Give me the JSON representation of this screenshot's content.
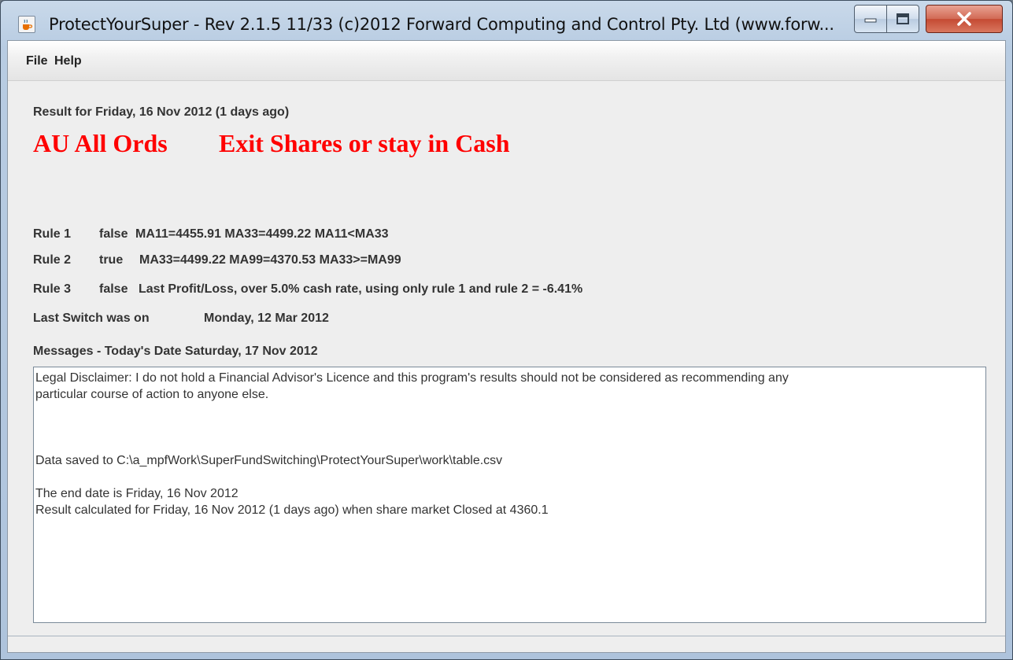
{
  "window": {
    "title": "ProtectYourSuper - Rev 2.1.5  11/33 (c)2012 Forward Computing and Control Pty. Ltd (www.forw...",
    "app_icon": "java-coffee-cup-icon",
    "controls": [
      "minimize-icon",
      "maximize-icon",
      "close-icon"
    ]
  },
  "menu": {
    "file": "File",
    "help": "Help"
  },
  "result": {
    "heading": "Result for Friday, 16 Nov 2012 (1 days ago)",
    "market": "AU All Ords",
    "advice": "Exit Shares or stay in Cash",
    "advice_color": "#ff0000"
  },
  "rules": [
    {
      "name": "Rule 1",
      "state": "false",
      "detail": "MA11=4455.91 MA33=4499.22  MA11<MA33"
    },
    {
      "name": "Rule 2",
      "state": "true",
      "detail": "MA33=4499.22 MA99=4370.53  MA33>=MA99"
    },
    {
      "name": "Rule 3",
      "state": "false",
      "detail": "Last Profit/Loss, over 5.0% cash rate, using only rule 1 and rule 2  =  -6.41%"
    }
  ],
  "last_switch": {
    "label": "Last Switch was on",
    "date": "Monday, 12 Mar 2012"
  },
  "messages": {
    "header": "Messages - Today's Date Saturday, 17 Nov 2012",
    "lines": [
      "Legal Disclaimer: I do not hold a Financial Advisor's Licence and this program's results should not be considered as recommending any",
      "particular course of action to anyone else.",
      "",
      "",
      "",
      "Data saved to C:\\a_mpfWork\\SuperFundSwitching\\ProtectYourSuper\\work\\table.csv",
      "",
      "The end date is Friday, 16 Nov 2012",
      "Result calculated for Friday, 16 Nov 2012 (1 days ago) when share market Closed at 4360.1"
    ]
  }
}
